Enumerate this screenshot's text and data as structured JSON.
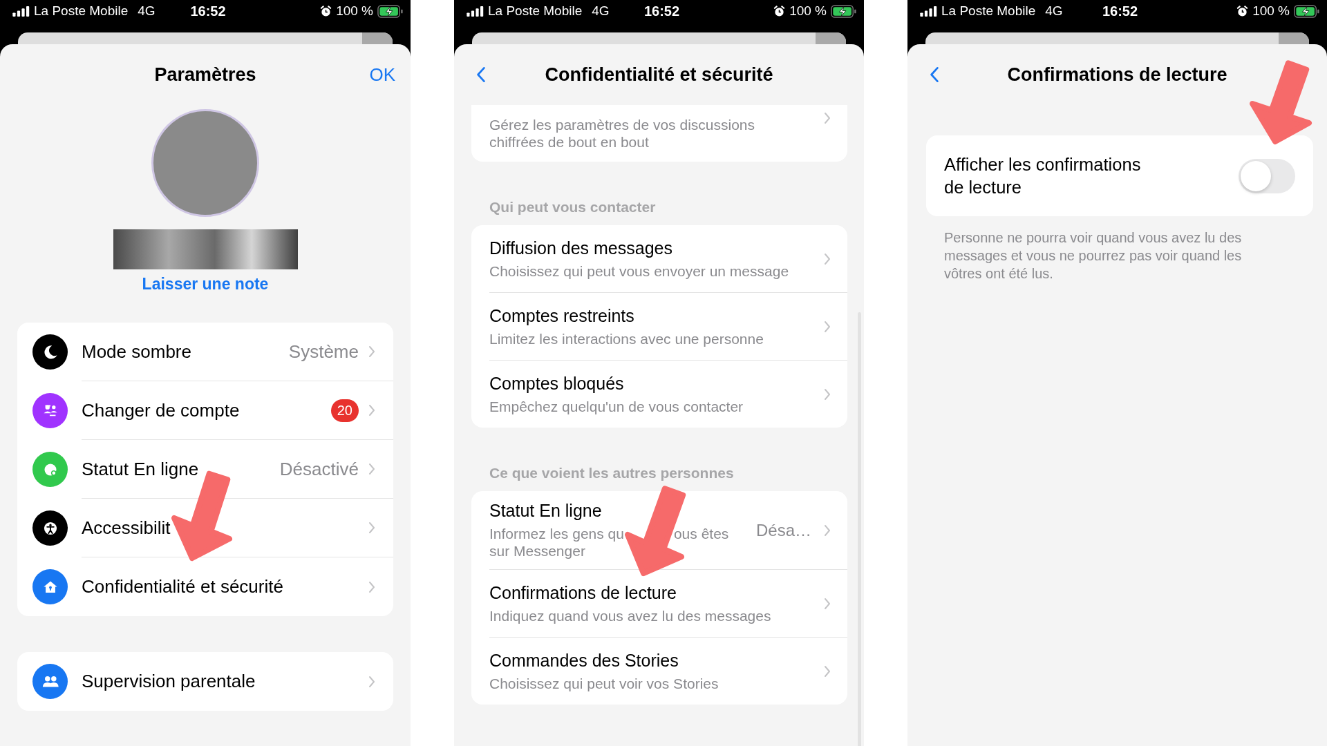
{
  "screens": [
    {
      "kind": "settings",
      "status_bar": {
        "carrier": "La Poste Mobile",
        "network": "4G",
        "time": "16:52",
        "battery": "100 %"
      },
      "title": "Paramètres",
      "done_button": "OK",
      "note_link": "Laisser une note",
      "groups": [
        {
          "rows": [
            {
              "label": "Mode sombre",
              "value": "Système",
              "color": "#000000"
            },
            {
              "label": "Changer de compte",
              "badge": "20",
              "color": "#a033ff"
            },
            {
              "label": "Statut En ligne",
              "value": "Désactivé",
              "color": "#31c94d"
            },
            {
              "label": "Accessibilit",
              "color": "#000000"
            },
            {
              "label": "Confidentialité et sécurité",
              "color": "#1877f2"
            }
          ]
        },
        {
          "rows": [
            {
              "label": "Supervision parentale",
              "color": "#1877f2"
            }
          ]
        }
      ]
    },
    {
      "kind": "privacy",
      "status_bar": {
        "carrier": "La Poste Mobile",
        "network": "4G",
        "time": "16:52",
        "battery": "100 %"
      },
      "title": "Confidentialité et sécurité",
      "partial_card": {
        "subtitle": "Gérez les paramètres de vos discussions chiffrées de bout en bout"
      },
      "sections": [
        {
          "header": "Qui peut vous contacter",
          "rows": [
            {
              "title": "Diffusion des messages",
              "subtitle": "Choisissez qui peut vous envoyer un message"
            },
            {
              "title": "Comptes restreints",
              "subtitle": "Limitez les interactions avec une personne"
            },
            {
              "title": "Comptes bloqués",
              "subtitle": "Empêchez quelqu'un de vous contacter"
            }
          ]
        },
        {
          "header": "Ce que voient les autres personnes",
          "rows": [
            {
              "title": "Statut En ligne",
              "subtitle": "Informez les gens qu",
              "subtitle_after_arrow": "ous êtes",
              "subtitle_line_2": "sur Messenger",
              "value": "Désa…"
            },
            {
              "title": "Confirmations de lecture",
              "subtitle": "Indiquez quand vous avez lu des messages"
            },
            {
              "title": "Commandes des Stories",
              "subtitle": "Choisissez qui peut voir vos Stories"
            }
          ]
        }
      ]
    },
    {
      "kind": "read_receipts",
      "status_bar": {
        "carrier": "La Poste Mobile",
        "network": "4G",
        "time": "16:52",
        "battery": "100 %"
      },
      "title": "Confirmations de lecture",
      "toggle": {
        "label": "Afficher les confirmations de lecture",
        "on": false
      },
      "footer": "Personne ne pourra voir quand vous avez lu des messages et vous ne pourrez pas voir quand les vôtres ont été lus."
    }
  ]
}
